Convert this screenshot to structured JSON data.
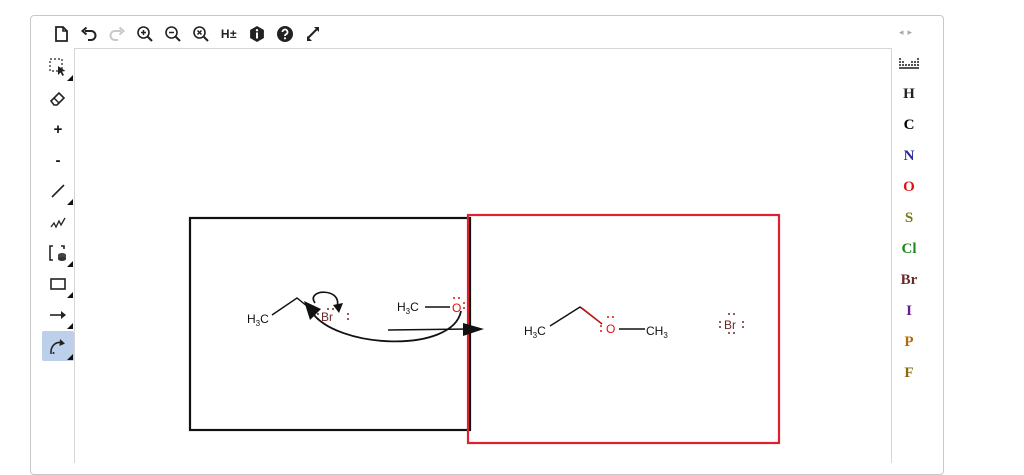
{
  "toolbar_top": {
    "items": [
      {
        "name": "new-document-icon"
      },
      {
        "name": "undo-icon"
      },
      {
        "name": "redo-icon"
      },
      {
        "name": "zoom-in-icon"
      },
      {
        "name": "zoom-out-icon"
      },
      {
        "name": "zoom-reset-icon"
      },
      {
        "name": "add-hydrogens-toggle",
        "label": "H±"
      },
      {
        "name": "info-icon"
      },
      {
        "name": "help-icon"
      },
      {
        "name": "fullscreen-icon"
      }
    ]
  },
  "toolbar_left": {
    "items": [
      {
        "name": "select-tool-icon"
      },
      {
        "name": "erase-tool-icon"
      },
      {
        "name": "charge-plus-button",
        "label": "+"
      },
      {
        "name": "charge-minus-button",
        "label": "-"
      },
      {
        "name": "bond-tool-icon"
      },
      {
        "name": "chain-tool-icon"
      },
      {
        "name": "bracket-tool-icon"
      },
      {
        "name": "rectangle-tool-icon"
      },
      {
        "name": "arrow-tool-icon"
      },
      {
        "name": "curved-arrow-tool-icon",
        "active": true
      }
    ]
  },
  "toolbar_right": {
    "atoms": [
      {
        "symbol": "H",
        "color": "#222222"
      },
      {
        "symbol": "C",
        "color": "#000000"
      },
      {
        "symbol": "N",
        "color": "#2b2b9a"
      },
      {
        "symbol": "O",
        "color": "#e01010"
      },
      {
        "symbol": "S",
        "color": "#7a7a10"
      },
      {
        "symbol": "Cl",
        "color": "#1e8a1e"
      },
      {
        "symbol": "Br",
        "color": "#6b2a2a"
      },
      {
        "symbol": "I",
        "color": "#6a1a8a"
      },
      {
        "symbol": "P",
        "color": "#b06a10"
      },
      {
        "symbol": "F",
        "color": "#8a6a10"
      }
    ]
  },
  "canvas": {
    "reactants": {
      "box_color": "#111111",
      "ethyl_label_main": "H",
      "ethyl_label_sub": "3",
      "ethyl_label_end": "C",
      "bromine": "Br",
      "methoxy_label_main": "H",
      "methoxy_label_sub": "3",
      "methoxy_label_end": "C",
      "oxygen": "O"
    },
    "products": {
      "box_color": "#e02030",
      "left_main": "H",
      "left_sub": "3",
      "left_end": "C",
      "oxygen": "O",
      "right_main": "CH",
      "right_sub": "3",
      "bromide": "Br",
      "oxygen_color": "#e01010",
      "bromine_color": "#6b2a2a"
    }
  }
}
